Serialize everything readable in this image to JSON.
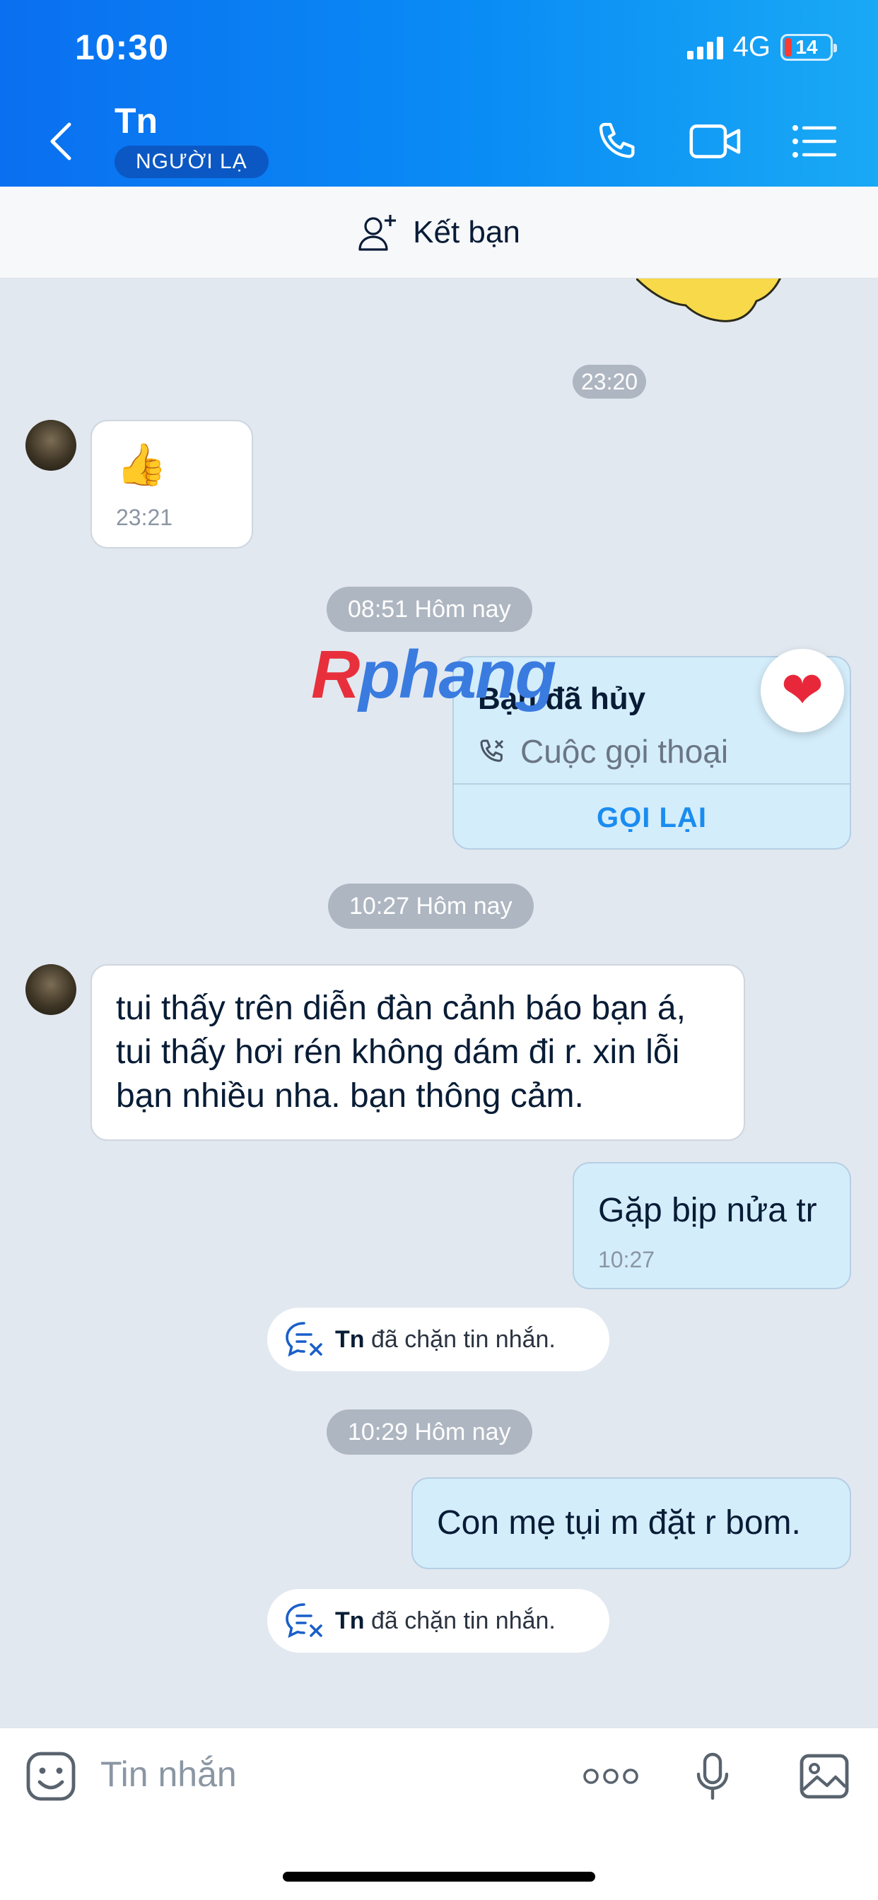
{
  "status_bar": {
    "time": "10:30",
    "network": "4G",
    "battery": "14"
  },
  "header": {
    "contact_name": "Tn",
    "badge": "NGƯỜI LẠ",
    "icons": [
      "back-icon",
      "phone-icon",
      "video-call-icon",
      "menu-list-icon"
    ]
  },
  "add_friend": {
    "label": "Kết bạn",
    "icon": "add-person-icon"
  },
  "messages": {
    "t1": "23:20",
    "thumb": {
      "emoji": "👍",
      "time": "23:21"
    },
    "t2": "08:51 Hôm nay",
    "call": {
      "title": "Bạn đã hủy",
      "subtitle": "Cuộc gọi thoại",
      "action": "GỌI LẠI",
      "reaction": "❤"
    },
    "t3": "10:27 Hôm nay",
    "incoming_text": {
      "line1": "tui thấy trên diễn đàn cảnh báo bạn á,",
      "line2": "tui thấy hơi rén không dám đi r. xin lỗi",
      "line3": "bạn nhiều nha. bạn thông cảm."
    },
    "out1": {
      "text": "Gặp bịp nửa tr",
      "time": "10:27"
    },
    "blocked1": {
      "name": "Tn",
      "text": "đã chặn tin nhắn."
    },
    "t4": "10:29 Hôm nay",
    "out2": {
      "text": "Con mẹ tụi m đặt r bom."
    },
    "blocked2": {
      "name": "Tn",
      "text": "đã chặn tin nhắn."
    }
  },
  "watermark": {
    "r": "R",
    "rest": "phang"
  },
  "composer": {
    "placeholder": "Tin nhắn",
    "icons": [
      "sticker-icon",
      "more-icon",
      "microphone-icon",
      "image-icon"
    ]
  },
  "colors": {
    "header_start": "#0a6ff0",
    "header_end": "#19a9f5",
    "outgoing": "#d4edfb",
    "link": "#1a8cf0"
  }
}
